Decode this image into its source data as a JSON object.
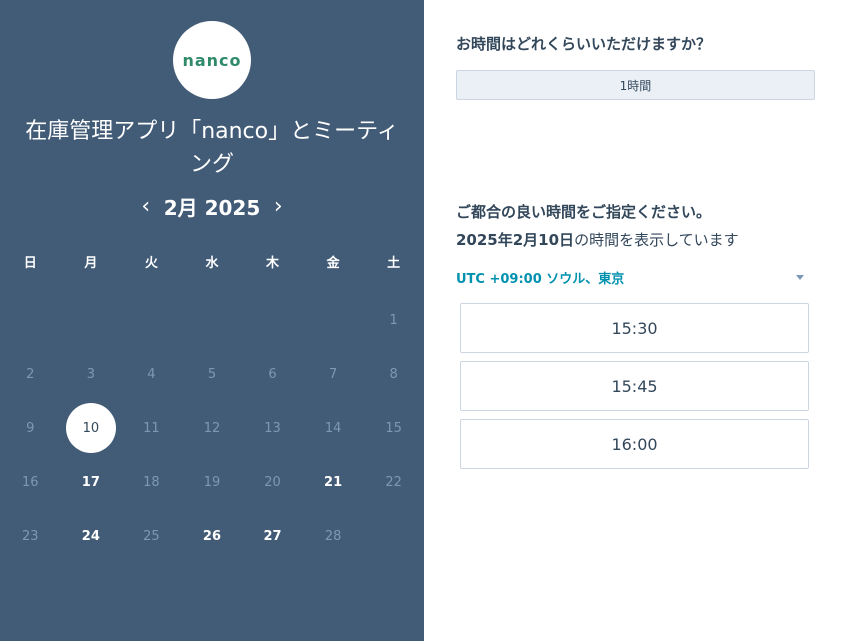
{
  "logo": {
    "text": "nanco"
  },
  "title_line1": "在庫管理アプリ「nanco」とミーティ",
  "title_line2": "ング",
  "calendar": {
    "prev_glyph": "‹",
    "next_glyph": "›",
    "month_label": "2月 2025",
    "weekdays": [
      "日",
      "月",
      "火",
      "水",
      "木",
      "金",
      "土"
    ],
    "weeks": [
      [
        "",
        "",
        "",
        "",
        "",
        "",
        "1"
      ],
      [
        "2",
        "3",
        "4",
        "5",
        "6",
        "7",
        "8"
      ],
      [
        "9",
        "10",
        "11",
        "12",
        "13",
        "14",
        "15"
      ],
      [
        "16",
        "17",
        "18",
        "19",
        "20",
        "21",
        "22"
      ],
      [
        "23",
        "24",
        "25",
        "26",
        "27",
        "28",
        ""
      ]
    ],
    "available_days": [
      "17",
      "21",
      "24",
      "26",
      "27"
    ],
    "selected_day": "10"
  },
  "duration": {
    "question": "お時間はどれくらいいただけますか？",
    "selected": "1時間"
  },
  "time_selection": {
    "question": "ご都合の良い時間をご指定ください。",
    "date_bold": "2025年2月10日",
    "date_suffix": "の時間を表示しています",
    "timezone": "UTC +09:00 ソウル、東京",
    "slots": [
      "15:30",
      "15:45",
      "16:00"
    ]
  },
  "colors": {
    "left_panel": "#425b76",
    "accent": "#0091ae",
    "text": "#33475b",
    "logo_text": "#2f8a6a"
  }
}
